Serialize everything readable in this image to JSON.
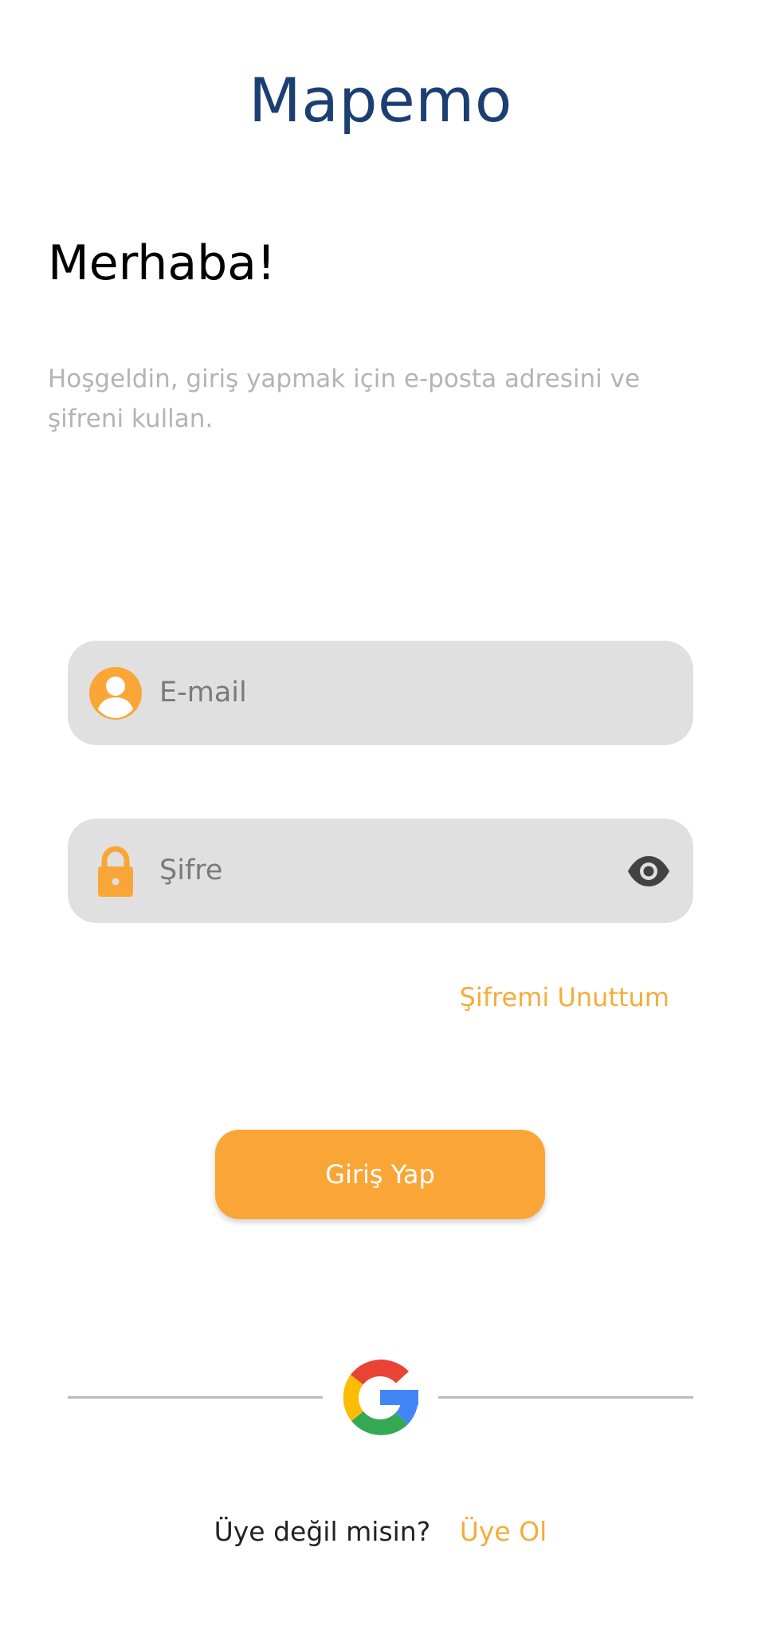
{
  "app": {
    "title": "Mapemo"
  },
  "welcome": {
    "heading": "Merhaba!",
    "subtitle": "Hoşgeldin, giriş yapmak için e-posta adresini ve şifreni kullan."
  },
  "form": {
    "email": {
      "placeholder": "E-mail",
      "value": "",
      "icon": "user-avatar-icon"
    },
    "password": {
      "placeholder": "Şifre",
      "value": "",
      "icon": "lock-icon",
      "toggle_icon": "eye-icon"
    },
    "forgot_label": "Şifremi Unuttum",
    "submit_label": "Giriş Yap"
  },
  "social": {
    "google_icon": "google-logo-icon"
  },
  "signup": {
    "prompt": "Üye değil misin?",
    "link_label": "Üye Ol"
  },
  "colors": {
    "brand_title": "#1b3f72",
    "accent": "#faa637",
    "field_background": "#e0e0e0",
    "subtitle_text": "#b4b4b4"
  }
}
